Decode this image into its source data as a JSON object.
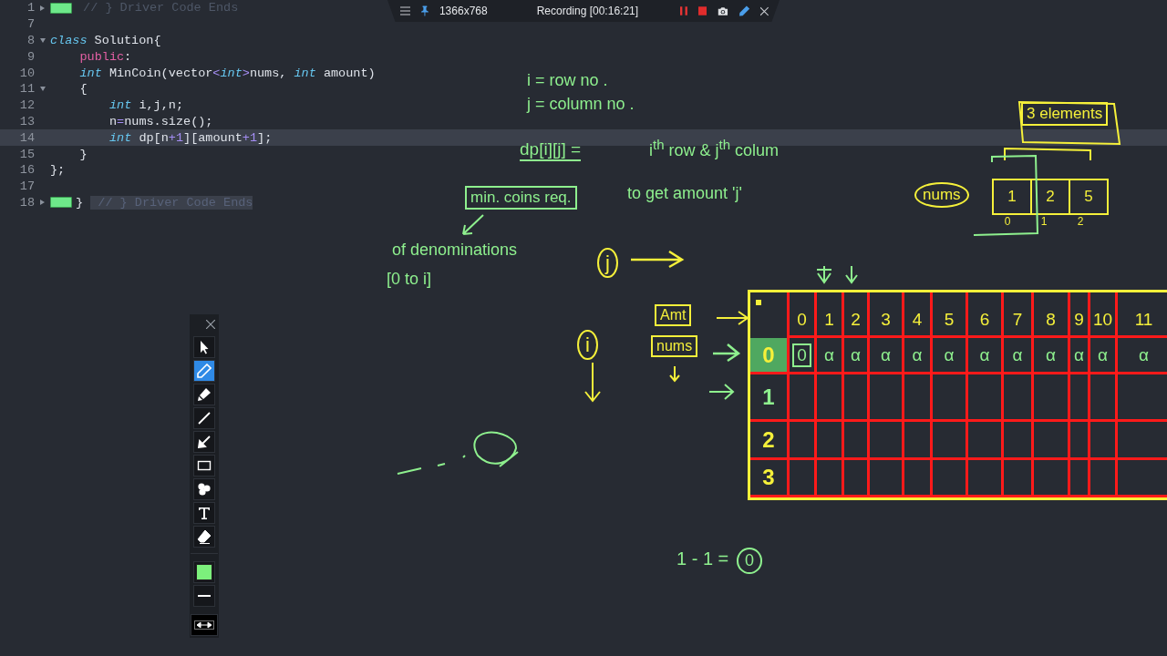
{
  "recorder_bar": {
    "resolution": "1366x768",
    "status": "Recording [00:16:21]",
    "paused": false
  },
  "editor": {
    "lines": [
      {
        "number": "1",
        "collapsed": true,
        "current": false,
        "tokens": [
          {
            "kind": "comment",
            "text": " // } Driver Code Ends"
          }
        ]
      },
      {
        "number": "7",
        "current": false
      },
      {
        "number": "8",
        "collapsed": false,
        "current": false,
        "tokens": [
          {
            "kind": "type",
            "text": "class"
          },
          {
            "kind": "plain",
            "text": " Solution{"
          }
        ],
        "children": [
          {
            "number": "9",
            "current": false,
            "tokens": [
              {
                "kind": "access",
                "text": "public"
              },
              {
                "kind": "plain",
                "text": ":"
              }
            ]
          },
          {
            "number": "10",
            "current": false,
            "tokens": [
              {
                "kind": "type",
                "text": "int"
              },
              {
                "kind": "plain",
                "text": " MinCoin(vector"
              },
              {
                "kind": "op",
                "text": "<"
              },
              {
                "kind": "type",
                "text": "int"
              },
              {
                "kind": "op",
                "text": ">"
              },
              {
                "kind": "plain",
                "text": "nums, "
              },
              {
                "kind": "type",
                "text": "int"
              },
              {
                "kind": "plain",
                "text": " amount)"
              }
            ]
          },
          {
            "number": "11",
            "collapsed": false,
            "current": false,
            "tokens": [
              {
                "kind": "plain",
                "text": "{"
              }
            ],
            "children": [
              {
                "number": "12",
                "current": false,
                "tokens": [
                  {
                    "kind": "type",
                    "text": "int"
                  },
                  {
                    "kind": "plain",
                    "text": " i,j,n;"
                  }
                ]
              },
              {
                "number": "13",
                "current": false,
                "tokens": [
                  {
                    "kind": "plain",
                    "text": "n"
                  },
                  {
                    "kind": "op",
                    "text": "="
                  },
                  {
                    "kind": "plain",
                    "text": "nums.size();"
                  }
                ]
              },
              {
                "number": "14",
                "current": true,
                "tokens": [
                  {
                    "kind": "type",
                    "text": "int"
                  },
                  {
                    "kind": "plain",
                    "text": " dp[n"
                  },
                  {
                    "kind": "op",
                    "text": "+1"
                  },
                  {
                    "kind": "plain",
                    "text": "][amount"
                  },
                  {
                    "kind": "op",
                    "text": "+1"
                  },
                  {
                    "kind": "plain",
                    "text": "];"
                  }
                ]
              }
            ]
          },
          {
            "number": "15",
            "current": false,
            "tokens": [
              {
                "kind": "plain",
                "text": "}"
              }
            ]
          }
        ]
      },
      {
        "number": "16",
        "current": false,
        "tokens": [
          {
            "kind": "plain",
            "text": "};"
          }
        ]
      },
      {
        "number": "17",
        "current": false
      },
      {
        "number": "18",
        "collapsed": true,
        "current": false,
        "tokens": [
          {
            "kind": "plain",
            "text": "} "
          },
          {
            "kind": "selected-comment",
            "text": " // } Driver Code Ends"
          }
        ]
      }
    ]
  },
  "annotations": [
    {
      "kind": "note",
      "text": "i = row no .",
      "color": "#8ef08e"
    },
    {
      "kind": "note",
      "text": "j = column no .",
      "color": "#8ef08e"
    },
    {
      "kind": "underlined",
      "text": "dp[i][j] =",
      "color": "#8ef08e"
    },
    {
      "kind": "note",
      "text": "i$^{th}$ row & j$^{th}$ colum",
      "color": "#8ef08e"
    },
    {
      "kind": "boxed",
      "text": "min. coins req.",
      "color": "#8ef08e"
    },
    {
      "kind": "note",
      "text": "to get amount 'j'",
      "color": "#8ef08e"
    },
    {
      "kind": "note",
      "text": "of denominations",
      "color": "#8ef08e"
    },
    {
      "kind": "note",
      "text": "[0 to i]",
      "color": "#8ef08e"
    },
    {
      "kind": "circled",
      "text": "j",
      "color": "#f5f03a"
    },
    {
      "kind": "circled",
      "text": "i",
      "color": "#f5f03a"
    },
    {
      "kind": "note",
      "text": "1 - 1 =",
      "color": "#8ef08e"
    },
    {
      "kind": "circled",
      "text": "0",
      "color": "#8ef08e"
    },
    {
      "kind": "boxed",
      "text": "3 elements",
      "color": "#f5f03a"
    },
    {
      "kind": "circled",
      "text": "nums",
      "color": "#f5f03a"
    },
    {
      "kind": "boxed",
      "text": "Amt",
      "color": "#f5f03a"
    },
    {
      "kind": "boxed",
      "text": "nums",
      "color": "#f5f03a"
    }
  ],
  "nums_array": {
    "values": [
      "1",
      "2",
      "5"
    ],
    "indexes": [
      "0",
      "1",
      "2"
    ]
  },
  "dp_table": {
    "amounts": [
      "0",
      "1",
      "2",
      "3",
      "4",
      "5",
      "6",
      "7",
      "8",
      "9",
      "10",
      "11"
    ],
    "rows": [
      {
        "label": "0",
        "color": "#f5f03a",
        "marked": true,
        "cells": [
          {
            "text": "0",
            "circled": true
          },
          {
            "text": "α",
            "circled": false
          },
          {
            "text": "α",
            "circled": false
          },
          {
            "text": "α",
            "circled": false
          },
          {
            "text": "α",
            "circled": false
          },
          {
            "text": "α",
            "circled": false
          },
          {
            "text": "α",
            "circled": false
          },
          {
            "text": "α",
            "circled": false
          },
          {
            "text": "α",
            "circled": false
          },
          {
            "text": "α",
            "circled": false
          },
          {
            "text": "α",
            "circled": false
          },
          {
            "text": "α",
            "circled": false
          }
        ]
      },
      {
        "label": "1",
        "color": "#8ef08e",
        "marked": false
      },
      {
        "label": "2",
        "color": "#f5f03a",
        "marked": false
      },
      {
        "label": "3",
        "color": "#f5f03a",
        "marked": false
      }
    ]
  },
  "toolbar": {
    "tools": [
      {
        "kind": "pointer",
        "selected": false
      },
      {
        "kind": "pen",
        "selected": true
      },
      {
        "kind": "highlighter",
        "selected": false
      },
      {
        "kind": "line",
        "selected": false
      },
      {
        "kind": "arrow",
        "selected": false
      },
      {
        "kind": "rectangle",
        "selected": false
      },
      {
        "kind": "numbering",
        "selected": false
      },
      {
        "kind": "text",
        "selected": false
      },
      {
        "kind": "eraser",
        "selected": false
      }
    ],
    "color": "#7cf07c"
  }
}
